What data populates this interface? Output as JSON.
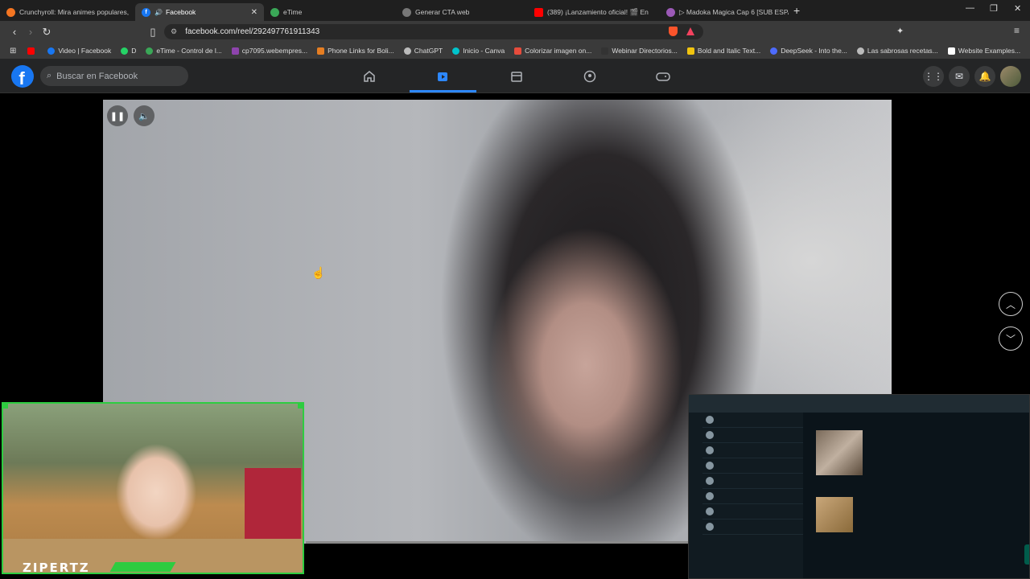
{
  "browser": {
    "tabs": [
      {
        "label": "Crunchyroll: Mira animes populares,",
        "color": "#f47521",
        "active": false
      },
      {
        "label": "Facebook",
        "color": "#1877f2",
        "active": true
      },
      {
        "label": "eTime",
        "color": "#3aa757",
        "active": false
      },
      {
        "label": "Generar CTA web",
        "color": "#999999",
        "active": false
      },
      {
        "label": "(389) ¡Lanzamiento oficial! 🎬 En",
        "color": "#ff0000",
        "active": false
      },
      {
        "label": "▷ Madoka Magica Cap 6 [SUB ESPA",
        "color": "#9b59b6",
        "active": false
      }
    ],
    "url": "facebook.com/reel/292497761911343",
    "bookmarks": [
      {
        "label": "",
        "color": "#ff0000"
      },
      {
        "label": "Video | Facebook",
        "color": "#1877f2"
      },
      {
        "label": "D",
        "color": "#25d366"
      },
      {
        "label": "eTime - Control de l...",
        "color": "#3aa757"
      },
      {
        "label": "cp7095.webempres...",
        "color": "#8e44ad"
      },
      {
        "label": "Phone Links for Boli...",
        "color": "#e67e22"
      },
      {
        "label": "ChatGPT",
        "color": "#bbbbbb"
      },
      {
        "label": "Inicio - Canva",
        "color": "#00c4cc"
      },
      {
        "label": "Colorizar imagen on...",
        "color": "#e74c3c"
      },
      {
        "label": "Webinar Directorios...",
        "color": "#333333"
      },
      {
        "label": "Bold and Italic Text...",
        "color": "#f1c40f"
      },
      {
        "label": "DeepSeek - Into the...",
        "color": "#4d6bfe"
      },
      {
        "label": "Las sabrosas recetas...",
        "color": "#bbbbbb"
      },
      {
        "label": "Website Examples...",
        "color": "#ffffff"
      }
    ]
  },
  "facebook": {
    "search_placeholder": "Buscar en Facebook",
    "logo": "f",
    "accent": "#1877f2"
  },
  "overlay": {
    "streamer_name": "ZIPERTZ"
  }
}
